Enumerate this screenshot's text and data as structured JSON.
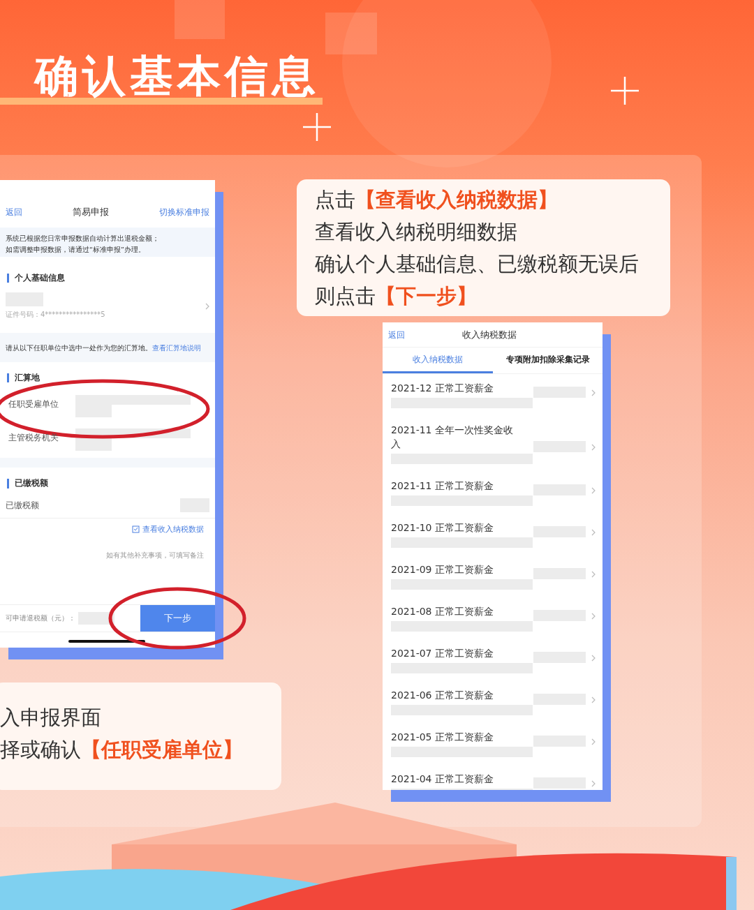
{
  "title": "确认基本信息",
  "left_phone": {
    "nav_back": "返回",
    "nav_title": "简易申报",
    "nav_action": "切换标准申报",
    "notice_lines": [
      "系统已根据您日常申报数据自动计算出退税金额；",
      "如需调整申报数据，请通过“标准申报”办理。"
    ],
    "section_personal": "个人基础信息",
    "id_number": "证件号码：4****************5",
    "hint": "请从以下任职单位中选中一处作为您的汇算地。",
    "hint_link": "查看汇算地说明",
    "section_place": "汇算地",
    "place_fields": [
      {
        "label": "任职受雇单位",
        "circled": true
      },
      {
        "label": "主管税务机关",
        "circled": false
      }
    ],
    "section_tax": "已缴税额",
    "tax_label": "已缴税额",
    "view_link": "查看收入纳税数据",
    "remark": "如有其他补充事项，可填写备注",
    "refund_label": "可申请退税额（元）：",
    "next_button": {
      "label": "下一步",
      "circled": true
    }
  },
  "right_callout": [
    [
      {
        "text": "点击",
        "highlight": false
      },
      {
        "text": "【查看收入纳税数据】",
        "highlight": true
      }
    ],
    [
      {
        "text": "查看收入纳税明细数据",
        "highlight": false
      }
    ],
    [
      {
        "text": "确认个人基础信息、已缴税额无误后",
        "highlight": false
      }
    ],
    [
      {
        "text": "则点击",
        "highlight": false
      },
      {
        "text": "【下一步】",
        "highlight": true
      }
    ]
  ],
  "right_phone": {
    "nav_back": "返回",
    "nav_title": "收入纳税数据",
    "tabs": [
      {
        "label": "收入纳税数据",
        "selected": true
      },
      {
        "label": "专项附加扣除采集记录",
        "selected": false
      }
    ],
    "rows": [
      {
        "title": "2021-12  正常工资薪金"
      },
      {
        "title": "2021-11  全年一次性奖金收入"
      },
      {
        "title": "2021-11  正常工资薪金"
      },
      {
        "title": "2021-10  正常工资薪金"
      },
      {
        "title": "2021-09  正常工资薪金"
      },
      {
        "title": "2021-08  正常工资薪金"
      },
      {
        "title": "2021-07  正常工资薪金"
      },
      {
        "title": "2021-06  正常工资薪金"
      },
      {
        "title": "2021-05  正常工资薪金"
      },
      {
        "title": "2021-04  正常工资薪金"
      }
    ]
  },
  "left_callout": [
    [
      {
        "text": "入申报界面",
        "highlight": false
      }
    ],
    [
      {
        "text": "择或确认",
        "highlight": false
      },
      {
        "text": "【任职受雇单位】",
        "highlight": true
      }
    ]
  ]
}
